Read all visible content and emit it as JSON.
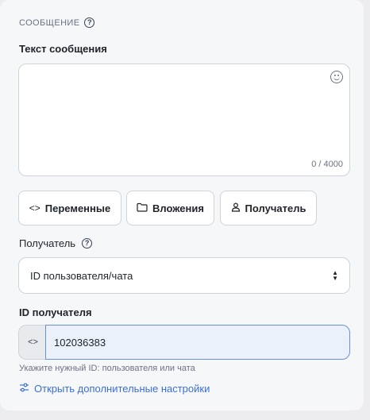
{
  "section": {
    "title": "СООБЩЕНИЕ",
    "help_icon": "question-circle-icon"
  },
  "message": {
    "label": "Текст сообщения",
    "value": "",
    "counter": "0 / 4000",
    "emoji_icon": "emoji-smile-icon"
  },
  "buttons": {
    "variables": {
      "icon": "<>",
      "label": "Переменные"
    },
    "attachments": {
      "icon": "folder-icon",
      "label": "Вложения"
    },
    "recipient": {
      "icon": "user-icon",
      "label": "Получатель"
    }
  },
  "recipient_type": {
    "label": "Получатель",
    "selected": "ID пользователя/чата"
  },
  "recipient_id": {
    "label": "ID получателя",
    "prefix": "<>",
    "value": "102036383",
    "hint": "Укажите нужный ID: пользователя или чата"
  },
  "advanced_link": {
    "label": "Открыть дополнительные настройки",
    "icon": "sliders-icon"
  }
}
